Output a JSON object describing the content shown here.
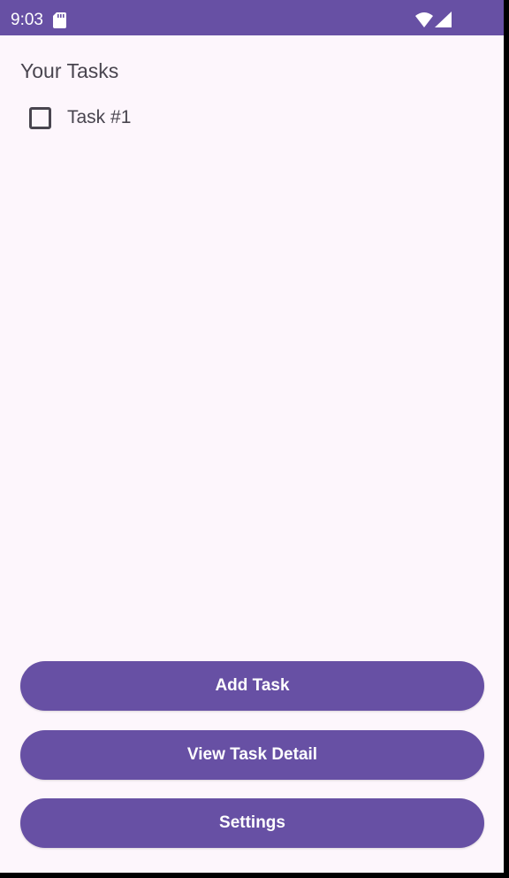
{
  "status_bar": {
    "time": "9:03",
    "sd_icon": "sd-card-icon",
    "wifi_icon": "wifi-icon",
    "signal_icon": "cell-signal-icon",
    "color": "#6750A4"
  },
  "main": {
    "title": "Your Tasks",
    "tasks": [
      {
        "label": "Task #1",
        "checked": false
      }
    ]
  },
  "actions": {
    "add_task": "Add Task",
    "view_task_detail": "View Task Detail",
    "settings": "Settings"
  },
  "colors": {
    "primary": "#6750A4",
    "background": "#FDF6FC",
    "on_surface": "#49454F"
  }
}
